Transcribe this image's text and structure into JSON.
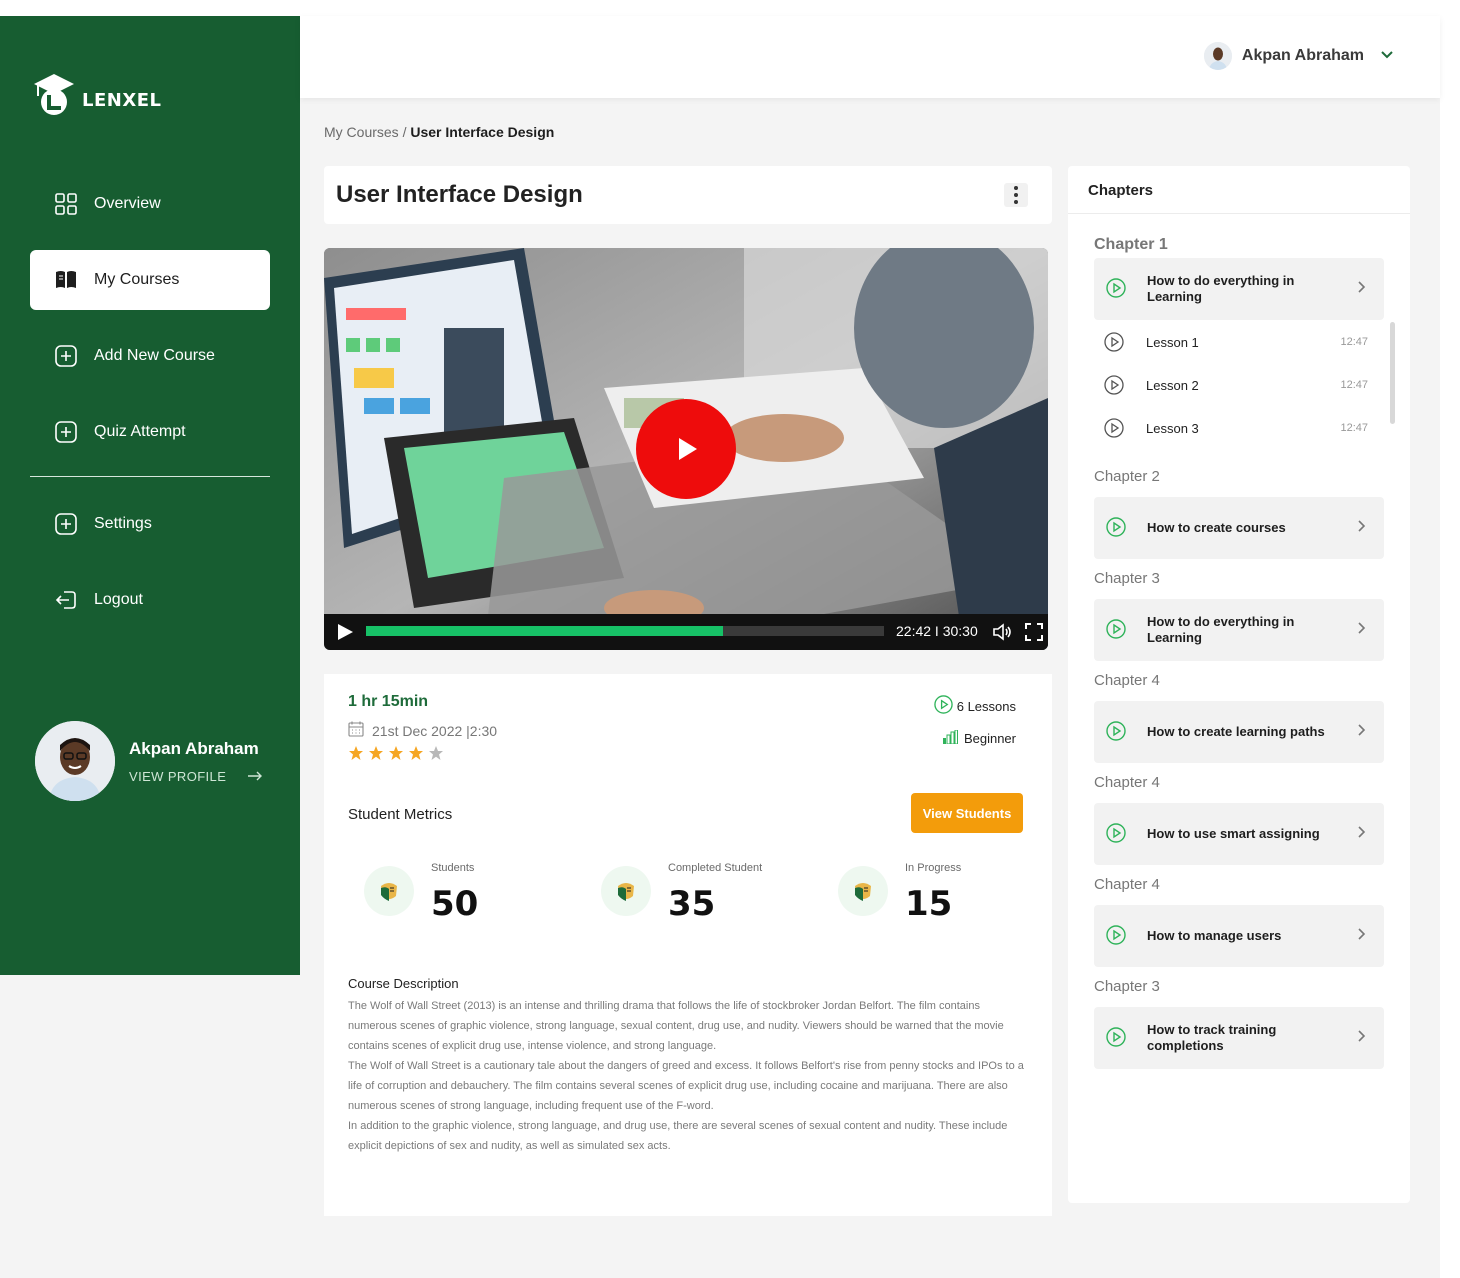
{
  "brand": {
    "name": "LENXEL"
  },
  "sidebar": {
    "items": [
      {
        "label": "Overview",
        "icon": "grid-icon"
      },
      {
        "label": "My Courses",
        "icon": "book-icon"
      },
      {
        "label": "Add New Course",
        "icon": "plus-square-icon"
      },
      {
        "label": "Quiz Attempt",
        "icon": "plus-square-icon"
      },
      {
        "label": "Settings",
        "icon": "plus-square-icon"
      },
      {
        "label": "Logout",
        "icon": "logout-icon"
      }
    ],
    "active": "My Courses",
    "profile": {
      "name": "Akpan Abraham",
      "link": "VIEW PROFILE"
    }
  },
  "header": {
    "user_name": "Akpan Abraham"
  },
  "breadcrumb": {
    "parent": "My Courses",
    "separator": "/",
    "current": "User Interface Design"
  },
  "course": {
    "title": "User Interface Design",
    "duration": "1 hr 15min",
    "date": "21st Dec 2022 |2:30",
    "rating": 4,
    "rating_max": 5,
    "lessons": "6 Lessons",
    "level": "Beginner"
  },
  "video": {
    "time": "22:42 I 30:30",
    "progress_fraction": 0.69
  },
  "metrics": {
    "title": "Student Metrics",
    "button": "View Students",
    "items": [
      {
        "label": "Students",
        "value": "50"
      },
      {
        "label": "Completed Student",
        "value": "35"
      },
      {
        "label": "In Progress",
        "value": "15"
      }
    ]
  },
  "description": {
    "title": "Course Description",
    "paragraphs": [
      "The Wolf of Wall Street (2013) is an intense and thrilling drama that follows the life of stockbroker Jordan Belfort. The film contains numerous scenes of graphic violence, strong language, sexual content, drug use, and nudity. Viewers should be warned that the movie contains scenes of explicit drug use, intense violence, and strong language.",
      "The Wolf of Wall Street is a cautionary tale about the dangers of greed and excess. It follows Belfort's rise from penny stocks and IPOs to a life of corruption and debauchery. The film contains several scenes of explicit drug use, including cocaine and marijuana. There are also numerous scenes of strong language, including frequent use of the F-word.",
      "In addition to the graphic violence, strong language, and drug use, there are several scenes of sexual content and nudity. These include explicit depictions of sex and nudity, as well as simulated sex acts."
    ]
  },
  "chapters": {
    "title": "Chapters",
    "list": [
      {
        "label": "Chapter 1",
        "item": "How to do everything in Learning",
        "lessons": [
          {
            "label": "Lesson 1",
            "time": "12:47"
          },
          {
            "label": "Lesson 2",
            "time": "12:47"
          },
          {
            "label": "Lesson 3",
            "time": "12:47"
          }
        ]
      },
      {
        "label": "Chapter 2",
        "item": "How to create courses"
      },
      {
        "label": "Chapter 3",
        "item": "How to do everything in Learning"
      },
      {
        "label": "Chapter 4",
        "item": "How to create learning paths"
      },
      {
        "label": "Chapter 4",
        "item": "How to use smart assigning"
      },
      {
        "label": "Chapter 4",
        "item": "How to manage users"
      },
      {
        "label": "Chapter 3",
        "item": "How to track training completions"
      }
    ]
  },
  "colors": {
    "sidebar": "#175d31",
    "accent_green": "#17c167",
    "button_orange": "#f39c0b",
    "play_red": "#ee0c0c",
    "star": "#f5a623"
  }
}
